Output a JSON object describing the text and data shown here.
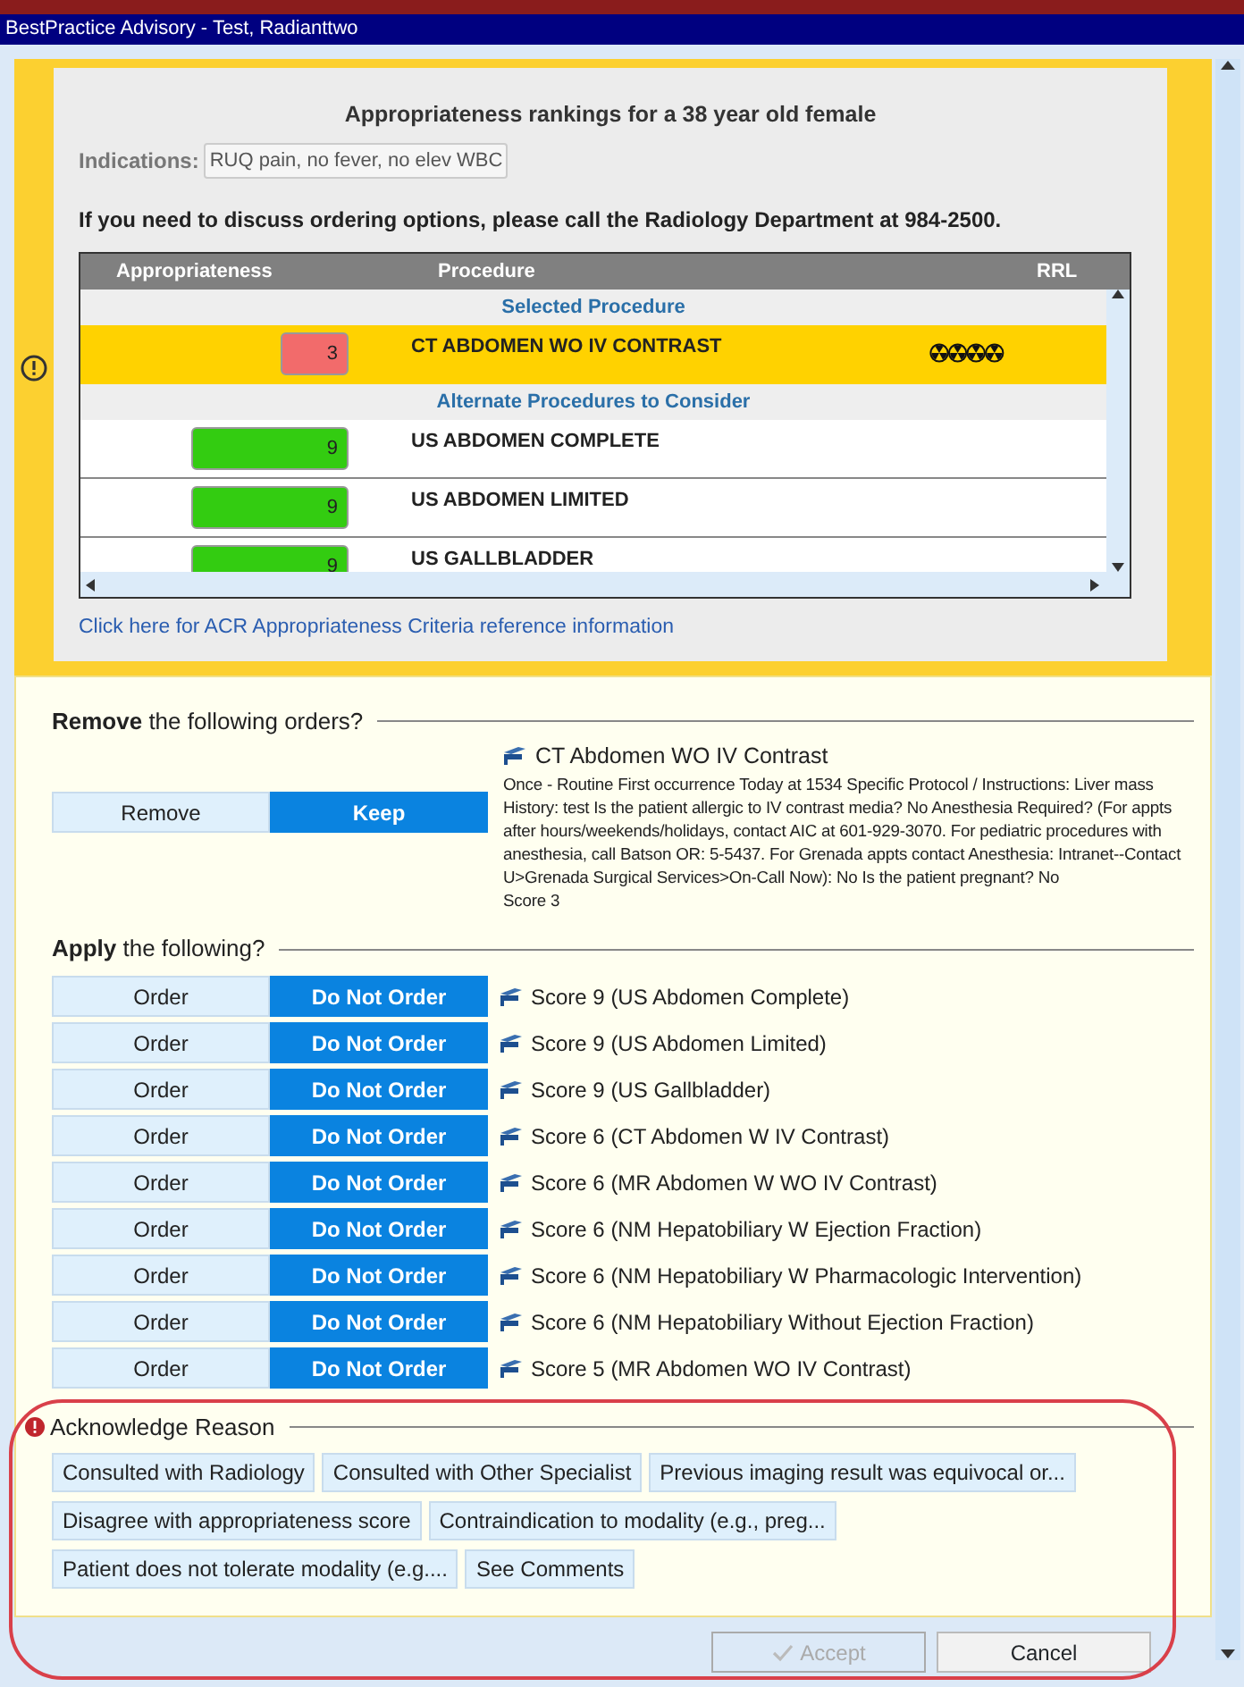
{
  "window": {
    "title": "BestPractice Advisory - Test, Radianttwo"
  },
  "advisory": {
    "heading": "Appropriateness rankings for a 38 year old female",
    "indications_label": "Indications:",
    "indications_value": "RUQ pain, no fever, no elev WBC",
    "notice": "If you need to discuss ordering options, please call the Radiology Department at 984-2500.",
    "table": {
      "columns": [
        "Appropriateness",
        "Procedure",
        "RRL"
      ],
      "groups": [
        {
          "heading": "Selected Procedure",
          "rows": [
            {
              "score": "3",
              "color": "#f26b6b",
              "procedure": "CT ABDOMEN WO IV CONTRAST",
              "selected": true,
              "radiation": true
            }
          ]
        },
        {
          "heading": "Alternate Procedures to Consider",
          "rows": [
            {
              "score": "9",
              "color": "#33cc11",
              "procedure": "US ABDOMEN COMPLETE",
              "selected": false,
              "radiation": false
            },
            {
              "score": "9",
              "color": "#33cc11",
              "procedure": "US ABDOMEN LIMITED",
              "selected": false,
              "radiation": false
            },
            {
              "score": "9",
              "color": "#33cc11",
              "procedure": "US GALLBLADDER",
              "selected": false,
              "radiation": false
            }
          ]
        }
      ]
    },
    "link": "Click here for ACR Appropriateness Criteria reference information"
  },
  "remove_section": {
    "heading": "**Remove** the following orders?",
    "buttons": [
      {
        "label": "Remove",
        "selected": false
      },
      {
        "label": "Keep",
        "selected": true
      }
    ],
    "order": {
      "title": "CT Abdomen WO IV Contrast",
      "details": "Once - Routine First occurrence Today at 1534 Specific Protocol / Instructions: Liver mass History: test Is the patient allergic to IV contrast media? No Anesthesia Required? (For appts after hours/weekends/holidays, contact AIC at 601-929-3070. For pediatric procedures with anesthesia, call Batson OR: 5-5437. For Grenada appts contact Anesthesia: Intranet--Contact U>Grenada Surgical Services>On-Call Now): No Is the patient pregnant? No",
      "score": "Score 3"
    }
  },
  "apply_section": {
    "heading": "**Apply** the following?",
    "items": [
      {
        "order_label": "Order",
        "skip_label": "Do Not Order",
        "ordered": false,
        "text": "Score 9 (US Abdomen Complete)"
      },
      {
        "order_label": "Order",
        "skip_label": "Do Not Order",
        "ordered": false,
        "text": "Score 9 (US Abdomen Limited)"
      },
      {
        "order_label": "Order",
        "skip_label": "Do Not Order",
        "ordered": false,
        "text": "Score 9 (US Gallbladder)"
      },
      {
        "order_label": "Order",
        "skip_label": "Do Not Order",
        "ordered": false,
        "text": "Score 6 (CT Abdomen W IV Contrast)"
      },
      {
        "order_label": "Order",
        "skip_label": "Do Not Order",
        "ordered": false,
        "text": "Score 6 (MR Abdomen W WO IV Contrast)"
      },
      {
        "order_label": "Order",
        "skip_label": "Do Not Order",
        "ordered": false,
        "text": "Score 6 (NM Hepatobiliary W Ejection Fraction)"
      },
      {
        "order_label": "Order",
        "skip_label": "Do Not Order",
        "ordered": false,
        "text": "Score 6 (NM Hepatobiliary W Pharmacologic Intervention)"
      },
      {
        "order_label": "Order",
        "skip_label": "Do Not Order",
        "ordered": false,
        "text": "Score 6 (NM Hepatobiliary Without Ejection Fraction)"
      },
      {
        "order_label": "Order",
        "skip_label": "Do Not Order",
        "ordered": false,
        "text": "Score 5 (MR Abdomen WO IV Contrast)"
      }
    ]
  },
  "acknowledge": {
    "heading": "Acknowledge Reason",
    "required": true,
    "reasons": [
      [
        "Consulted with Radiology",
        "Consulted with Other Specialist",
        "Previous imaging result was equivocal or..."
      ],
      [
        "Disagree with appropriateness score",
        "Contraindication to modality (e.g., preg..."
      ],
      [
        "Patient does not tolerate modality (e.g....",
        "See Comments"
      ]
    ]
  },
  "footer": {
    "buttons": [
      {
        "label": "Accept",
        "disabled": true
      },
      {
        "label": "Cancel",
        "disabled": false
      }
    ]
  }
}
